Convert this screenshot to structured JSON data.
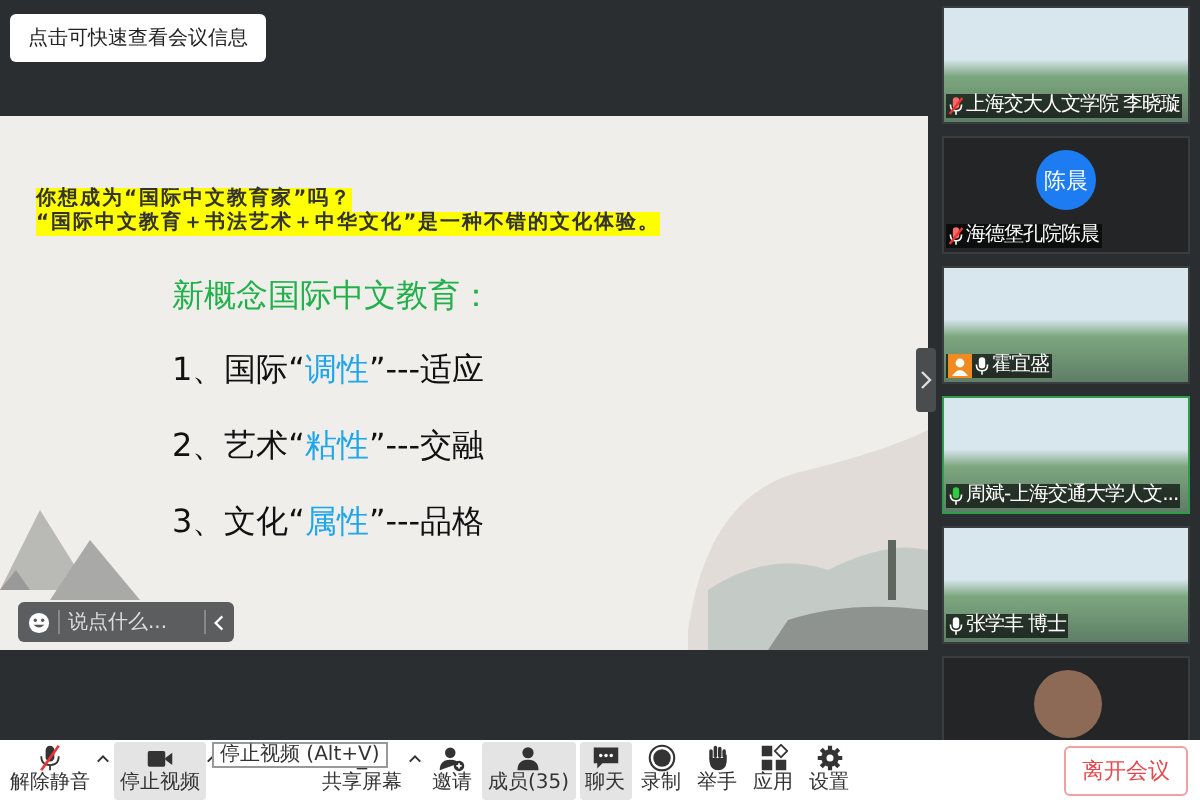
{
  "info_tooltip": "点击可快速查看会议信息",
  "slide": {
    "question_lines": [
      "你想成为“国际中文教育家”吗？",
      "“国际中文教育＋书法艺术＋中华文化”是一种不错的文化体验。"
    ],
    "heading": "新概念国际中文教育：",
    "points": [
      {
        "prefix": "1、国际“",
        "highlight": "调性",
        "suffix": "”---适应"
      },
      {
        "prefix": "2、艺术“",
        "highlight": "粘性",
        "suffix": "”---交融"
      },
      {
        "prefix": "3、文化“",
        "highlight": "属性",
        "suffix": "”---品格"
      }
    ]
  },
  "chat_box": {
    "placeholder": "说点什么..."
  },
  "participants": [
    {
      "kind": "video",
      "name": "上海交大人文学院 李晓璇",
      "muted": true,
      "speaking": false,
      "host": false
    },
    {
      "kind": "avatar",
      "initials": "陈晨",
      "name": "海德堡孔院陈晨",
      "muted": true,
      "speaking": false,
      "host": false
    },
    {
      "kind": "video",
      "name": "霍宜盛",
      "muted": false,
      "speaking": false,
      "host": true
    },
    {
      "kind": "video",
      "name": "周斌-上海交通大学人文...",
      "muted": false,
      "speaking": true,
      "host": false
    },
    {
      "kind": "video",
      "name": "张学丰 博士",
      "muted": false,
      "speaking": false,
      "host": false
    },
    {
      "kind": "photo-avatar"
    }
  ],
  "toolbar": [
    {
      "kind": "mic",
      "label": "解除静音",
      "muted": true,
      "caret": true,
      "selected": false
    },
    {
      "kind": "video",
      "label": "停止视频",
      "caret": true,
      "selected": true
    },
    {
      "kind": "share",
      "label": "共享屏幕",
      "caret": true,
      "selected": false
    },
    {
      "kind": "invite",
      "label": "邀请",
      "caret": false,
      "selected": false
    },
    {
      "kind": "members",
      "label": "成员(35)",
      "caret": false,
      "selected": true
    },
    {
      "kind": "chat",
      "label": "聊天",
      "caret": false,
      "selected": true
    },
    {
      "kind": "record",
      "label": "录制",
      "caret": false,
      "selected": false
    },
    {
      "kind": "hand",
      "label": "举手",
      "caret": false,
      "selected": false
    },
    {
      "kind": "apps",
      "label": "应用",
      "caret": false,
      "selected": false
    },
    {
      "kind": "settings",
      "label": "设置",
      "caret": false,
      "selected": false
    }
  ],
  "video_tooltip": "停止视频 (Alt+V)",
  "leave_button": "离开会议"
}
